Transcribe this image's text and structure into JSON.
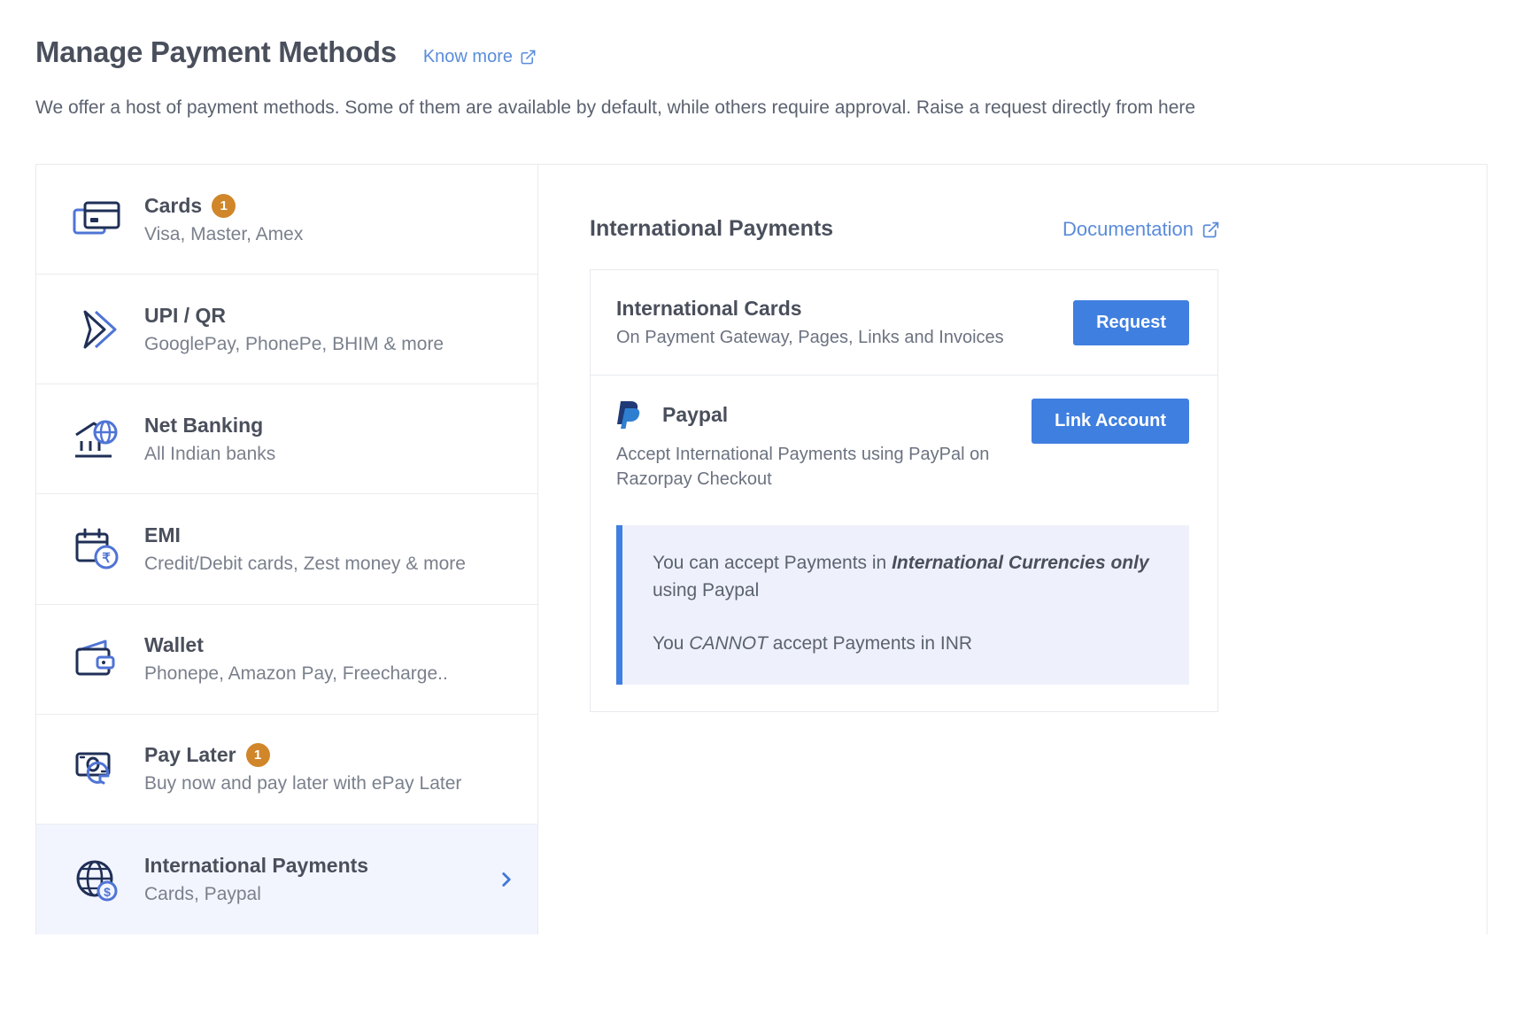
{
  "header": {
    "title": "Manage Payment Methods",
    "know_more_label": "Know more",
    "know_more_icon": "external-link-icon",
    "description": "We offer a host of payment methods. Some of them are available by default, while others require approval. Raise a request directly from here"
  },
  "colors": {
    "accent_blue": "#3f7fe0",
    "link_blue": "#5a8cdb",
    "badge_amber": "#d08629",
    "notice_bg": "#eef1fb",
    "selected_row_bg": "#f2f5fd",
    "title_gray": "#4a4f5c",
    "sub_gray": "#7a808c"
  },
  "methods": [
    {
      "icon": "credit-card-icon",
      "title": "Cards",
      "badge": "1",
      "sub": "Visa, Master, Amex",
      "selected": false
    },
    {
      "icon": "upi-qr-icon",
      "title": "UPI / QR",
      "badge": "",
      "sub": "GooglePay, PhonePe, BHIM & more",
      "selected": false
    },
    {
      "icon": "net-banking-icon",
      "title": "Net Banking",
      "badge": "",
      "sub": "All Indian banks",
      "selected": false
    },
    {
      "icon": "emi-calendar-icon",
      "title": "EMI",
      "badge": "",
      "sub": "Credit/Debit cards, Zest money & more",
      "selected": false
    },
    {
      "icon": "wallet-icon",
      "title": "Wallet",
      "badge": "",
      "sub": "Phonepe, Amazon Pay, Freecharge..",
      "selected": false
    },
    {
      "icon": "pay-later-icon",
      "title": "Pay Later",
      "badge": "1",
      "sub": "Buy now and pay later with ePay Later",
      "selected": false
    },
    {
      "icon": "globe-dollar-icon",
      "title": "International Payments",
      "badge": "",
      "sub": "Cards, Paypal",
      "selected": true
    }
  ],
  "detail": {
    "title": "International Payments",
    "documentation_label": "Documentation",
    "documentation_icon": "external-link-icon",
    "international_cards": {
      "title": "International Cards",
      "sub": "On Payment Gateway, Pages, Links and Invoices",
      "button_label": "Request"
    },
    "paypal": {
      "logo_icon": "paypal-icon",
      "title": "Paypal",
      "sub": "Accept International Payments using PayPal on Razorpay Checkout",
      "button_label": "Link Account",
      "notice": {
        "line1_pre": "You can accept Payments in ",
        "line1_em": "International Currencies only",
        "line1_post": " using Paypal",
        "line2_pre": "You ",
        "line2_em": "CANNOT",
        "line2_post": " accept Payments in INR"
      }
    }
  }
}
